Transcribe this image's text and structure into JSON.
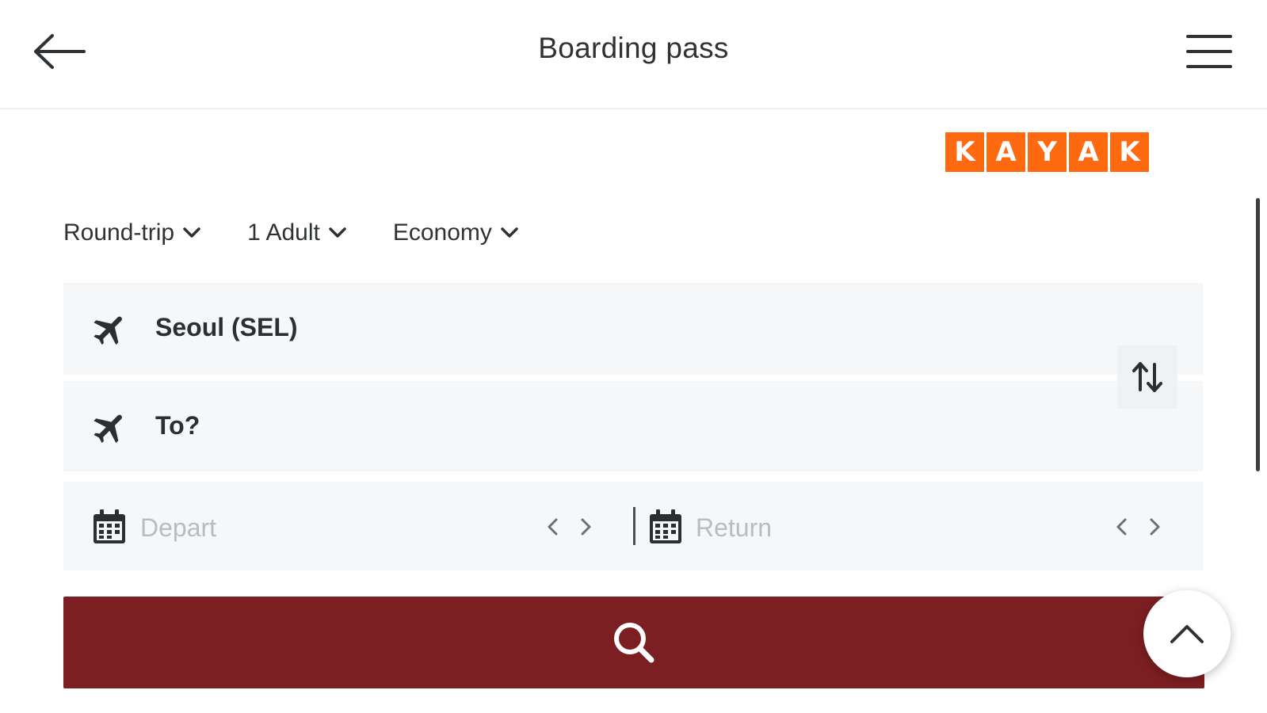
{
  "header": {
    "title": "Boarding pass"
  },
  "brand": {
    "letters": [
      "K",
      "A",
      "Y",
      "A",
      "K"
    ],
    "color": "#ff690f"
  },
  "options": {
    "trip_type": "Round-trip",
    "travelers": "1 Adult",
    "cabin": "Economy"
  },
  "fields": {
    "origin": "Seoul (SEL)",
    "destination": "To?",
    "depart_placeholder": "Depart",
    "return_placeholder": "Return"
  },
  "colors": {
    "search_button": "#7c1f23",
    "field_background": "#f6f7f8"
  },
  "icons": {
    "back": "arrow-left-icon",
    "menu": "hamburger-menu-icon",
    "plane": "plane-icon",
    "swap": "swap-vertical-icon",
    "calendar": "calendar-icon",
    "search": "search-icon",
    "scroll_top": "chevron-up-icon"
  }
}
